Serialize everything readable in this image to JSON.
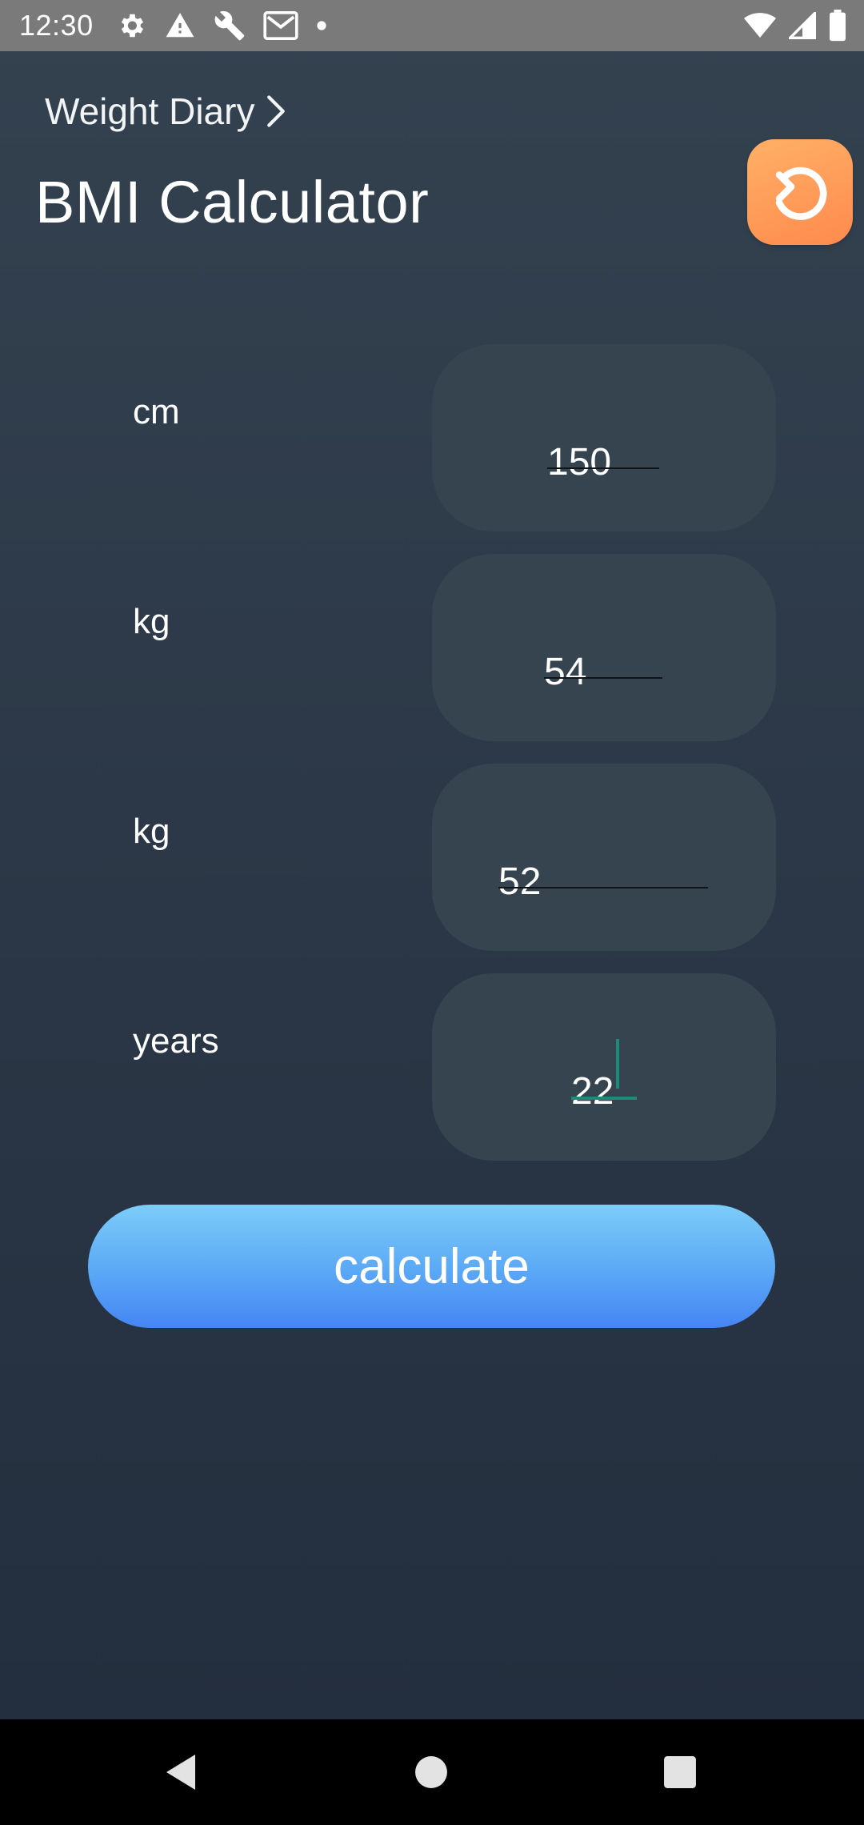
{
  "status_bar": {
    "time": "12:30",
    "left_icons": [
      "settings-icon",
      "warning-icon",
      "wrench-icon",
      "gmail-icon",
      "dot-icon"
    ],
    "right_icons": [
      "wifi-icon",
      "signal-icon",
      "battery-icon"
    ]
  },
  "header": {
    "breadcrumb": "Weight Diary",
    "title": "BMI Calculator",
    "reset_icon": "refresh-icon",
    "reset_color": "#ff9a58"
  },
  "fields": [
    {
      "unit": "cm",
      "value": "150"
    },
    {
      "unit": "kg",
      "value": "54"
    },
    {
      "unit": "kg",
      "value": "52"
    },
    {
      "unit": "years",
      "value": "22"
    }
  ],
  "calculate": {
    "label": "calculate",
    "color": "#5aa7f6"
  },
  "nav_bar": {
    "back_icon": "back-icon",
    "home_icon": "home-icon",
    "recents_icon": "recents-icon"
  },
  "colors": {
    "background": "#2c3847",
    "field_box": "#35444e",
    "focus_accent": "#1e8a78"
  }
}
